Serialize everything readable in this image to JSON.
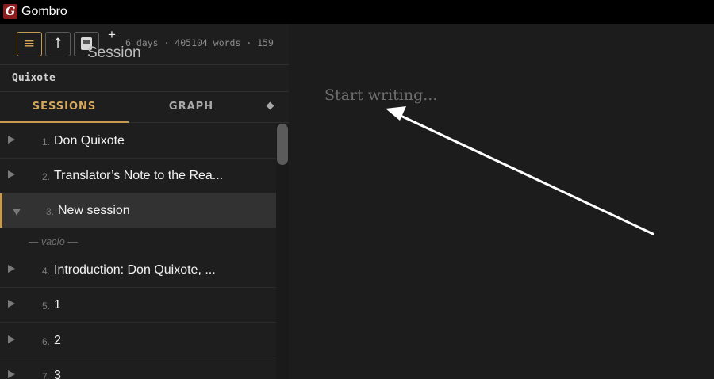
{
  "window": {
    "logo_letter": "G",
    "title": "Gombro"
  },
  "toolbar": {
    "menu_icon": "≡",
    "up_icon": "↑",
    "plus_label": "+",
    "stats": "6 days · 405104 words · 159",
    "tooltip": "Session"
  },
  "project": {
    "name": "Quixote"
  },
  "tabs": {
    "sessions": "SESSIONS",
    "graph": "GRAPH"
  },
  "sessions": [
    {
      "num": "1.",
      "title": "Don Quixote",
      "expanded": false
    },
    {
      "num": "2.",
      "title": "Translator’s Note to the Rea...",
      "expanded": false
    },
    {
      "num": "3.",
      "title": "New session",
      "expanded": true,
      "selected": true,
      "empty_note": "— vacío —"
    },
    {
      "num": "4.",
      "title": "Introduction: Don Quixote, ...",
      "expanded": false
    },
    {
      "num": "5.",
      "title": "1",
      "expanded": false
    },
    {
      "num": "6.",
      "title": "2",
      "expanded": false
    },
    {
      "num": "7.",
      "title": "3",
      "expanded": false
    }
  ],
  "editor": {
    "placeholder": "Start writing..."
  },
  "colors": {
    "accent": "#c89b53",
    "logo": "#8a1e1e",
    "background": "#1c1c1c"
  }
}
